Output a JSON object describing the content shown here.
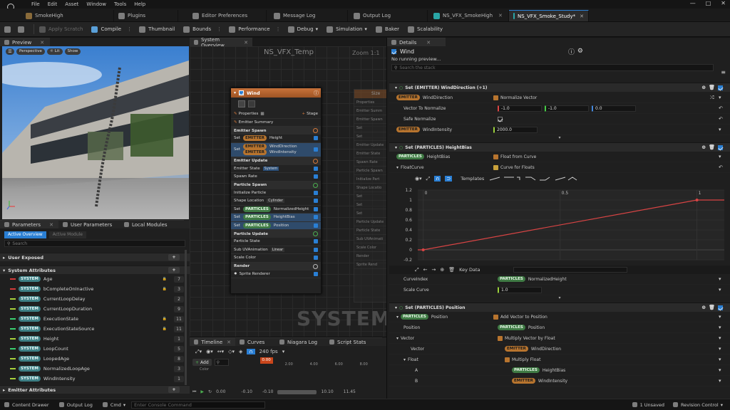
{
  "menu": {
    "items": [
      "File",
      "Edit",
      "Asset",
      "Window",
      "Tools",
      "Help"
    ]
  },
  "tabs": [
    {
      "label": "SmokeHigh",
      "active": false
    },
    {
      "label": "Plugins",
      "active": false
    },
    {
      "label": "Editor Preferences",
      "active": false
    },
    {
      "label": "Message Log",
      "active": false
    },
    {
      "label": "Output Log",
      "active": false
    },
    {
      "label": "NS_VFX_SmokeHigh",
      "active": false
    },
    {
      "label": "NS_VFX_Smoke_Study*",
      "active": true
    }
  ],
  "toolbar": {
    "apply_scratch": "Apply Scratch",
    "compile": "Compile",
    "thumbnail": "Thumbnail",
    "bounds": "Bounds",
    "performance": "Performance",
    "debug": "Debug",
    "simulation": "Simulation",
    "baker": "Baker",
    "scalability": "Scalability"
  },
  "preview": {
    "tab": "Preview",
    "perspective": "Perspective",
    "lit": "Lit",
    "show": "Show"
  },
  "params": {
    "tabs": [
      "Parameters",
      "User Parameters",
      "Local Modules"
    ],
    "subtabs": [
      "Active Overview",
      "Active Module"
    ],
    "search_placeholder": "Search",
    "sections": {
      "user_exposed": "User Exposed",
      "system_attributes": "System Attributes",
      "emitter_attributes": "Emitter Attributes"
    },
    "attrs": [
      {
        "name": "Age",
        "count": "7",
        "color": "#d43b3b"
      },
      {
        "name": "bCompleteOnInactive",
        "count": "3",
        "color": "#d43b3b"
      },
      {
        "name": "CurrentLoopDelay",
        "count": "2",
        "color": "#a8d13b"
      },
      {
        "name": "CurrentLoopDuration",
        "count": "9",
        "color": "#a8d13b"
      },
      {
        "name": "ExecutionState",
        "count": "11",
        "color": "#3bcf70"
      },
      {
        "name": "ExecutionStateSource",
        "count": "11",
        "color": "#3bcf70"
      },
      {
        "name": "Height",
        "count": "1",
        "color": "#a8d13b"
      },
      {
        "name": "LoopCount",
        "count": "5",
        "color": "#3bcf70"
      },
      {
        "name": "LoopedAge",
        "count": "8",
        "color": "#a8d13b"
      },
      {
        "name": "NormalizedLoopAge",
        "count": "3",
        "color": "#a8d13b"
      },
      {
        "name": "WindIntensity",
        "count": "1",
        "color": "#a8d13b"
      }
    ],
    "pill_system": "SYSTEM"
  },
  "overview": {
    "tab": "System Overview",
    "title": "NS_VFX_Temp",
    "zoom": "Zoom 1:1",
    "watermark": "SYSTEM",
    "node_title": "Wind",
    "properties": "Properties",
    "stage": "Stage",
    "emitter_summary": "Emitter Summary",
    "emitter_spawn": "Emitter Spawn",
    "emitter_update": "Emitter Update",
    "particle_spawn": "Particle Spawn",
    "particle_update": "Particle Update",
    "render": "Render",
    "set": "Set",
    "emitter": "EMITTER",
    "particles": "PARTICLES",
    "system": "System",
    "height": "Height",
    "wind_direction": "WindDirection",
    "wind_intensity": "WindIntensity",
    "emitter_state": "Emitter State",
    "spawn_rate": "Spawn Rate",
    "initialize_particle": "Initialize Particle",
    "shape_location": "Shape Location",
    "cylinder": "Cylinder",
    "normalized_height": "NormalizedHeight",
    "height_bias": "HeightBias",
    "position": "Position",
    "particle_state": "Particle State",
    "sub_uv": "Sub UVAnimation",
    "linear": "Linear",
    "scale_color": "Scale Color",
    "sprite_renderer": "Sprite Renderer",
    "ghost_title": "Size",
    "ghost_rows": [
      "Properties",
      "Emitter Summ",
      "Emitter Spawn",
      "Set",
      "Set",
      "Emitter Update",
      "Emitter State",
      "Spawn Rate",
      "Particle Spawn",
      "Initialize Part",
      "Shape Locatio",
      "Set",
      "Set",
      "Set",
      "Particle Update",
      "Particle State",
      "Sub UVAnimati",
      "Scale Color",
      "Render",
      "Sprite Rend"
    ]
  },
  "timeline": {
    "tabs": [
      "Timeline",
      "Curves",
      "Niagara Log",
      "Script Stats"
    ],
    "fps": "240 fps",
    "add": "Add",
    "cursor": "0.00",
    "ticks": [
      "2.00",
      "4.00",
      "6.00",
      "8.00"
    ],
    "start": "0.00",
    "range_start": "-0.10",
    "range_start2": "-0.10",
    "range_end": "10.10",
    "range_end2": "11.45",
    "track": "Color"
  },
  "details": {
    "tab": "Details",
    "title": "Wind",
    "no_preview": "No running preview...",
    "search_placeholder": "Search the stack",
    "s1_title": "Set (EMITTER) WindDirection (+1)",
    "wind_direction": "WindDirection",
    "normalize_vector": "Normalize Vector",
    "vector_to_normalize": "Vector To Normalize",
    "vx": "-1.0",
    "vy": "-1.0",
    "vz": "0.0",
    "safe_normalize": "Safe Normalize",
    "wind_intensity": "WindIntensity",
    "wind_intensity_val": "2000.0",
    "s2_title": "Set (PARTICLES) HeightBias",
    "height_bias": "HeightBias",
    "float_from_curve": "Float from Curve",
    "float_curve": "FloatCurve",
    "curve_for_floats": "Curve for Floats",
    "templates": "Templates",
    "y_ticks": [
      "1.2",
      "1",
      "0.8",
      "0.6",
      "0.4",
      "0.2",
      "0",
      "-0.2"
    ],
    "x_ticks": [
      "0",
      "0.5",
      "1"
    ],
    "key_data": "Key Data",
    "curve_index": "CurveIndex",
    "normalized_height": "NormalizedHeight",
    "scale_curve": "Scale Curve",
    "scale_curve_val": "1.0",
    "s3_title": "Set (PARTICLES) Position",
    "position": "Position",
    "add_vector": "Add Vector to Position",
    "vector": "Vector",
    "multiply_vector": "Multiply Vector by Float",
    "float": "Float",
    "multiply_float": "Multiply Float",
    "a": "A",
    "b": "B",
    "emitter": "EMITTER",
    "particles": "PARTICLES"
  },
  "statusbar": {
    "content_drawer": "Content Drawer",
    "output_log": "Output Log",
    "cmd": "Cmd",
    "console_placeholder": "Enter Console Command",
    "unsaved": "1 Unsaved",
    "revision": "Revision Control"
  },
  "colors": {
    "accent": "#2a7fd4",
    "emitter": "#b7742e",
    "particles": "#3f7a44",
    "system": "#3d7f85",
    "curve": "#d84444"
  }
}
